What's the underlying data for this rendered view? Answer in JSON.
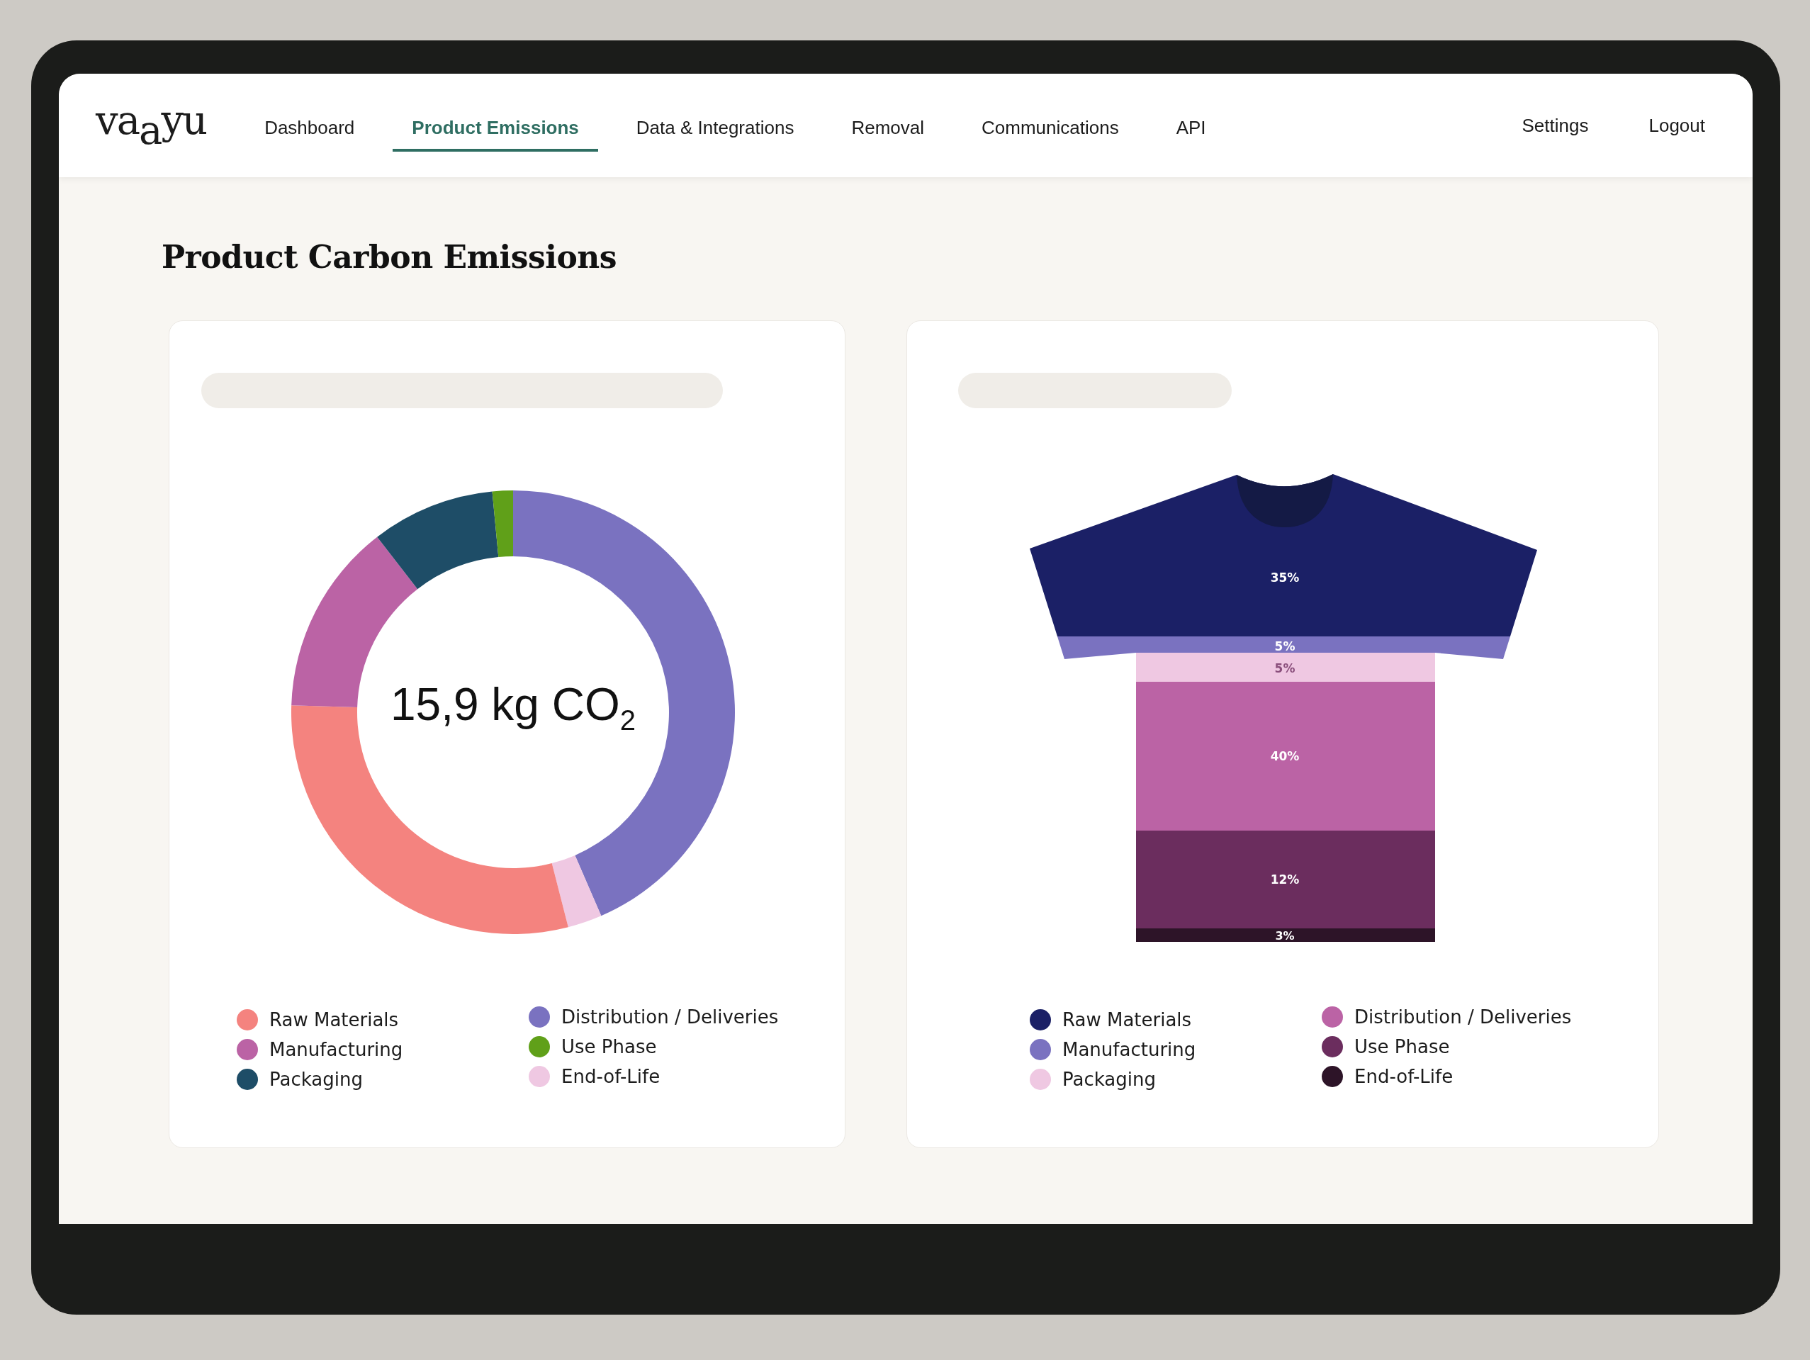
{
  "nav": {
    "logo": "va$_{a}$yu",
    "tabs": [
      {
        "label": "Dashboard",
        "selected": false
      },
      {
        "label": "Product Emissions",
        "selected": true
      },
      {
        "label": "Data & Integrations",
        "selected": false
      },
      {
        "label": "Removal",
        "selected": false
      },
      {
        "label": "Communications",
        "selected": false
      },
      {
        "label": "API",
        "selected": false
      }
    ],
    "right_links": [
      "Settings",
      "Logout"
    ]
  },
  "page_title": "Product Carbon Emissions",
  "donut_card": {
    "total": "15,9 kg CO$_{2}$",
    "legend": [
      {
        "label": "Raw Materials",
        "color": "#f4837f"
      },
      {
        "label": "Manufacturing",
        "color": "#bb63a5"
      },
      {
        "label": "Packaging",
        "color": "#1e4d67"
      },
      {
        "label": "Distribution / Deliveries",
        "color": "#7a72c0"
      },
      {
        "label": "Use Phase",
        "color": "#60a019"
      },
      {
        "label": "End-of-Life",
        "color": "#efc8e2"
      }
    ]
  },
  "shirt_card": {
    "bands": [
      {
        "label": "35%",
        "color": "#1b2066"
      },
      {
        "label": "5%",
        "color": "#7a72c0"
      },
      {
        "label": "5%",
        "color": "#efc8e2"
      },
      {
        "label": "40%",
        "color": "#bb63a5"
      },
      {
        "label": "12%",
        "color": "#6b2d5e"
      },
      {
        "label": "3%",
        "color": "#2d1428"
      }
    ],
    "legend": [
      {
        "label": "Raw Materials",
        "color": "#1b2066"
      },
      {
        "label": "Manufacturing",
        "color": "#7a72c0"
      },
      {
        "label": "Packaging",
        "color": "#efc8e2"
      },
      {
        "label": "Distribution / Deliveries",
        "color": "#bb63a5"
      },
      {
        "label": "Use Phase",
        "color": "#6b2d5e"
      },
      {
        "label": "End-of-Life",
        "color": "#2d1428"
      }
    ]
  }
}
